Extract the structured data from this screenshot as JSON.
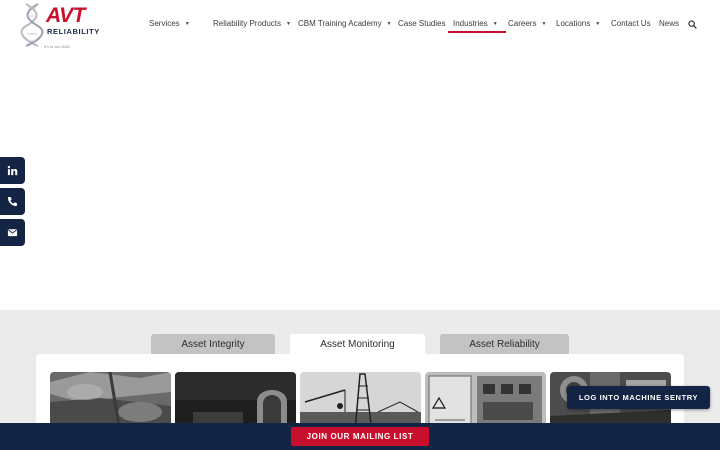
{
  "header": {
    "logo": {
      "brand": "AVT",
      "sub": "RELIABILITY",
      "tagline": "It's in our DNA"
    },
    "nav": [
      {
        "label": "Services",
        "dropdown": true
      },
      {
        "label": "Reliability Products",
        "dropdown": true
      },
      {
        "label": "CBM Training Academy",
        "dropdown": true
      },
      {
        "label": "Case Studies",
        "dropdown": false
      },
      {
        "label": "Industries",
        "dropdown": true,
        "active": true
      },
      {
        "label": "Careers",
        "dropdown": true
      },
      {
        "label": "Locations",
        "dropdown": true
      },
      {
        "label": "Contact Us",
        "dropdown": false
      },
      {
        "label": "News",
        "dropdown": false
      }
    ],
    "search_icon": "search-icon"
  },
  "social": [
    {
      "icon": "linkedin-icon"
    },
    {
      "icon": "phone-icon"
    },
    {
      "icon": "envelope-icon"
    }
  ],
  "tabs": [
    {
      "label": "Asset Integrity",
      "active": false
    },
    {
      "label": "Asset Monitoring",
      "active": true
    },
    {
      "label": "Asset Reliability",
      "active": false
    }
  ],
  "thumbnails": [
    {
      "subject": "corroded-metal-photo"
    },
    {
      "subject": "industrial-arch-photo"
    },
    {
      "subject": "offshore-rig-photo"
    },
    {
      "subject": "control-panel-photo"
    },
    {
      "subject": "machinery-photo"
    }
  ],
  "buttons": {
    "mailing": "JOIN OUR MAILING LIST",
    "sentry": "LOG INTO MACHINE SENTRY"
  },
  "colors": {
    "brand_red": "#c8102e",
    "navy": "#142445",
    "gray_section": "#ebebeb",
    "tab_inactive": "#c3c3c3"
  }
}
